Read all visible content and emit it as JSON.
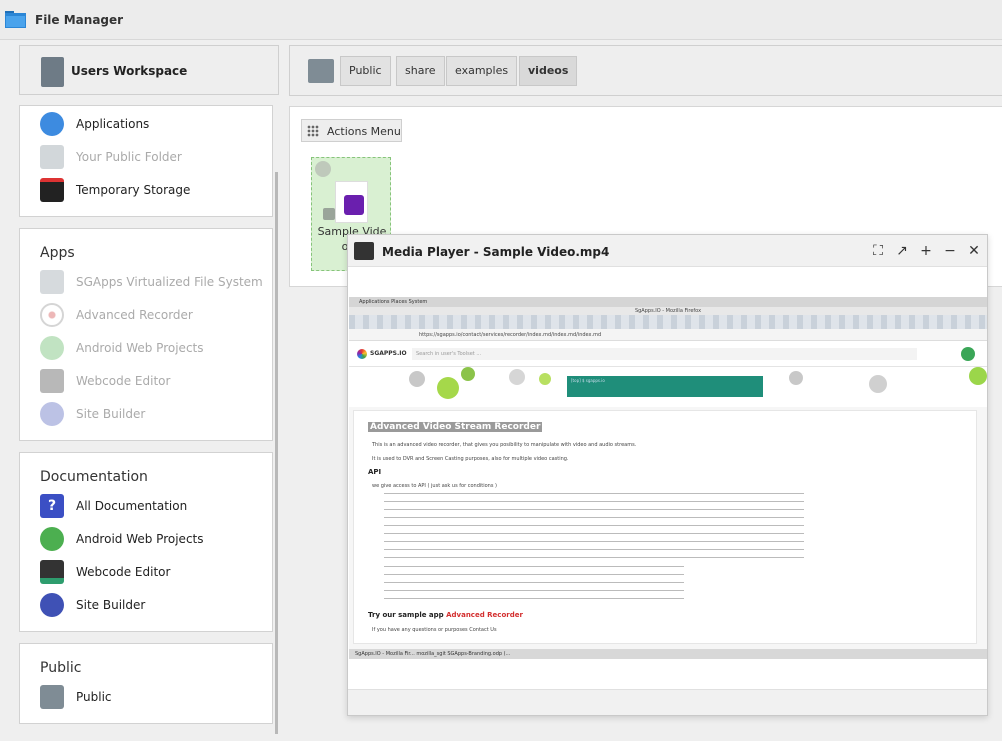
{
  "window": {
    "title": "File Manager"
  },
  "workspace": {
    "label": "Users Workspace"
  },
  "sidebar": {
    "places": [
      {
        "label": "Applications",
        "icon": "compass-icon",
        "enabled": true
      },
      {
        "label": "Your Public Folder",
        "icon": "folder-icon",
        "enabled": false
      },
      {
        "label": "Temporary Storage",
        "icon": "sd-card-icon",
        "enabled": true
      }
    ],
    "apps": {
      "heading": "Apps",
      "items": [
        {
          "label": "SGApps Virtualized File System",
          "icon": "filesystem-icon"
        },
        {
          "label": "Advanced Recorder",
          "icon": "record-icon"
        },
        {
          "label": "Android Web Projects",
          "icon": "android-icon"
        },
        {
          "label": "Webcode Editor",
          "icon": "code-editor-icon"
        },
        {
          "label": "Site Builder",
          "icon": "globe-gear-icon"
        }
      ]
    },
    "documentation": {
      "heading": "Documentation",
      "items": [
        {
          "label": "All Documentation",
          "icon": "question-icon"
        },
        {
          "label": "Android Web Projects",
          "icon": "android-icon"
        },
        {
          "label": "Webcode Editor",
          "icon": "code-editor-icon"
        },
        {
          "label": "Site Builder",
          "icon": "globe-gear-icon"
        }
      ]
    },
    "public": {
      "heading": "Public",
      "items": [
        {
          "label": "Public",
          "icon": "folder-user-icon"
        }
      ]
    }
  },
  "breadcrumb": {
    "items": [
      "Public",
      "share",
      "examples",
      "videos"
    ],
    "active": "videos"
  },
  "actions": {
    "label": "Actions Menu"
  },
  "files": [
    {
      "name_line1": "Sample Vide",
      "name_line2": "o.m"
    }
  ],
  "player": {
    "title": "Media Player - Sample Video.mp4",
    "controls": [
      "fullscreen-icon",
      "popout-icon",
      "maximize-icon",
      "minimize-icon",
      "close-icon"
    ]
  },
  "video_frame": {
    "os_menu": "Applications  Places  System",
    "browser_title": "SgApps.IO - Mozilla Firefox",
    "url": "https://sgapps.io/contact/services/recorder/index.md/index.md/index.md",
    "site_name": "SGAPPS.IO",
    "search_placeholder": "Search in user's Toolset ...",
    "doc_title": "Advanced Video Stream Recorder",
    "intro1": "This is an advanced video recorder, that gives you posibility to manipulate with video and audio streams.",
    "intro2": "It is used to DVR and Screen Casting purposes, also for multiple video casting.",
    "api_heading": "API",
    "api_line": "we give access to API ( just ask us for conditions )",
    "try_text": "Try our sample app",
    "try_link": "Advanced Recorder",
    "contact": "If you have any questions or purposes  Contact Us",
    "taskbar": "SgApps.IO - Mozilla Fir...   mozilla_sgit   SGApps-Branding.odp (..."
  }
}
